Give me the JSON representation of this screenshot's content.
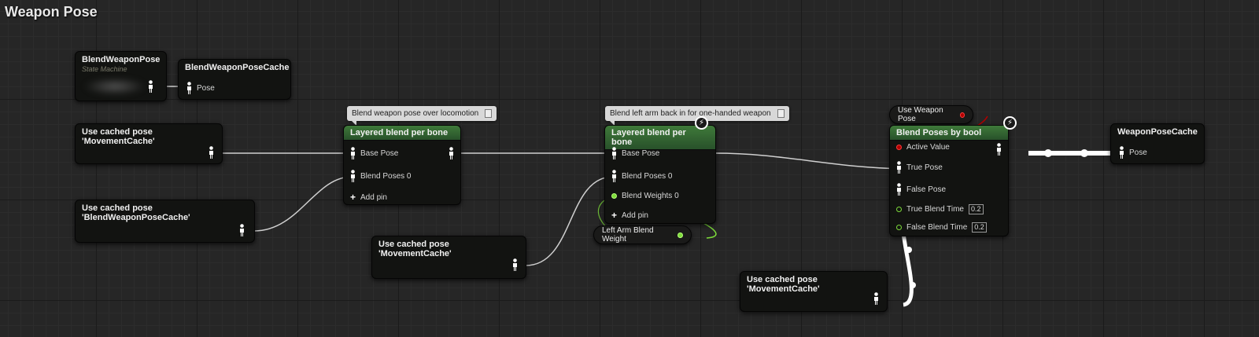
{
  "graph": {
    "title": "Weapon Pose"
  },
  "nodes": {
    "state_machine": {
      "title": "BlendWeaponPose",
      "subtitle": "State Machine"
    },
    "cache_weapon": {
      "title": "BlendWeaponPoseCache",
      "pin": "Pose"
    },
    "cached_movement_1": {
      "title": "Use cached pose 'MovementCache'"
    },
    "cached_blendweapon": {
      "title": "Use cached pose 'BlendWeaponPoseCache'"
    },
    "layered1": {
      "comment": "Blend weapon pose over locomotion",
      "title": "Layered blend per bone",
      "pins": [
        "Base Pose",
        "Blend Poses 0",
        "Add pin"
      ]
    },
    "cached_movement_2": {
      "title": "Use cached pose 'MovementCache'"
    },
    "layered2": {
      "comment": "Blend left arm back in for one-handed weapon",
      "title": "Layered blend per bone",
      "pins": [
        "Base Pose",
        "Blend Poses 0",
        "Blend Weights 0",
        "Add pin"
      ]
    },
    "left_arm_weight": {
      "label": "Left Arm Blend Weight"
    },
    "use_weapon_pose": {
      "label": "Use Weapon Pose"
    },
    "blend_bool": {
      "title": "Blend Poses by bool",
      "pins": [
        "Active Value",
        "True Pose",
        "False Pose",
        "True Blend Time",
        "False Blend Time"
      ],
      "true_blend_time": "0.2",
      "false_blend_time": "0.2"
    },
    "cached_movement_3": {
      "title": "Use cached pose 'MovementCache'"
    },
    "weapon_pose_cache": {
      "title": "WeaponPoseCache",
      "pin": "Pose"
    }
  },
  "icons": {
    "pose_pin": "person-icon",
    "fast_path": "lightning-bolt-icon",
    "add": "plus-icon",
    "comment_pin": "pushpin-icon"
  },
  "colors": {
    "header_green": "#3f7a3a",
    "float_pin": "#7ddc3a",
    "bool_pin": "#b10000",
    "wire": "#cfcfcf"
  }
}
